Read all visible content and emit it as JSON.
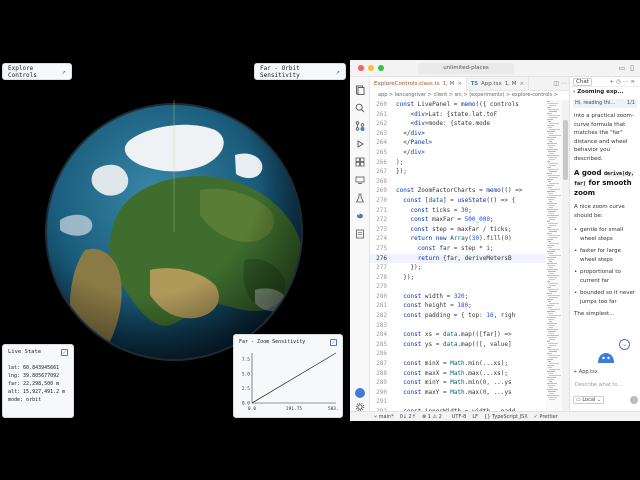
{
  "globe": {
    "explore_title": "Explore Controls",
    "orbit_title": "Far - Orbit Sensitivity",
    "live_state": {
      "title": "Live State",
      "lat": "lat: 60.843945661",
      "lng": "lng: 39.805677092",
      "far": "far: 22,298,500 m",
      "alt": "alt: 15,927,491.2 m",
      "mode": "mode: orbit"
    },
    "zoom_chart": {
      "title": "Far - Zoom Sensitivity"
    }
  },
  "chart_data": {
    "type": "line",
    "title": "Far - Zoom Sensitivity",
    "xlabel": "",
    "ylabel": "",
    "x_ticks": [
      "0.0",
      "291.75",
      "583.50"
    ],
    "y_ticks": [
      "7.5",
      "5.0",
      "2.5",
      "0.0"
    ],
    "xlim": [
      0,
      583.5
    ],
    "ylim": [
      0,
      8.6
    ],
    "series": [
      {
        "x": [
          0,
          583.5
        ],
        "y": [
          0,
          8.6
        ]
      }
    ]
  },
  "editor": {
    "title_search": "unlimited-places",
    "tabs": [
      {
        "label": "ExploreControls.class.ts",
        "suffix": "1, M"
      },
      {
        "label": "App.tsx",
        "suffix": "1, M",
        "badge": "TS"
      }
    ],
    "breadcrumb": "app > lancangriver > client > src > (experiments) > explore-controls >",
    "code_lines": [
      {
        "n": "260",
        "t": "const LivePanel = memo(({ controls"
      },
      {
        "n": "261",
        "t": "    <div>Lat: {state.lat.toF"
      },
      {
        "n": "262",
        "t": "    <div>mode: {state.mode"
      },
      {
        "n": "263",
        "t": "  </div>"
      },
      {
        "n": "264",
        "t": "  </Panel>"
      },
      {
        "n": "265",
        "t": "  </div>"
      },
      {
        "n": "266",
        "t": ");"
      },
      {
        "n": "267",
        "t": "});"
      },
      {
        "n": "268",
        "t": ""
      },
      {
        "n": "269",
        "t": "const ZoomFactorCharts = memo(() =>"
      },
      {
        "n": "270",
        "t": "  const [data] = useState(() => {"
      },
      {
        "n": "271",
        "t": "    const ticks = 30;"
      },
      {
        "n": "272",
        "t": "    const maxFar = 500_000;"
      },
      {
        "n": "273",
        "t": "    const step = maxFar / ticks;"
      },
      {
        "n": "274",
        "t": "    return new Array(30).fill(0)"
      },
      {
        "n": "275",
        "t": "      const far = step * i;"
      },
      {
        "n": "276",
        "t": "      return {far, deriveMetersB"
      },
      {
        "n": "277",
        "t": "    });"
      },
      {
        "n": "278",
        "t": "  });"
      },
      {
        "n": "279",
        "t": ""
      },
      {
        "n": "280",
        "t": "  const width = 320;"
      },
      {
        "n": "281",
        "t": "  const height = 180;"
      },
      {
        "n": "282",
        "t": "  const padding = { top: 16, righ"
      },
      {
        "n": "283",
        "t": ""
      },
      {
        "n": "284",
        "t": "  const xs = data.map(([far]) =>"
      },
      {
        "n": "285",
        "t": "  const ys = data.map(([, value]"
      },
      {
        "n": "286",
        "t": ""
      },
      {
        "n": "287",
        "t": "  const minX = Math.min(...xs);"
      },
      {
        "n": "288",
        "t": "  const maxX = Math.max(...xs);"
      },
      {
        "n": "289",
        "t": "  const minY = Math.min(0, ...ys"
      },
      {
        "n": "290",
        "t": "  const maxY = Math.max(0, ...ys"
      },
      {
        "n": "291",
        "t": ""
      },
      {
        "n": "292",
        "t": "  const innerWidth = width - padd"
      },
      {
        "n": "293",
        "t": "  const innerHeight = height - pa"
      }
    ],
    "chat": {
      "tab": "Chat",
      "subtitle": "Zooming exp...",
      "preview": "Hi, reading thi...",
      "preview_count": "1/1",
      "intro": "into a practical zoom-curve formula that matches the \"far\" distance and wheel behavior you described.",
      "heading_pre": "A good",
      "heading_code": "derive(dy, far)",
      "heading_post": "for smooth zoom",
      "lead": "A nice zoom curve should be:",
      "bullets": [
        "gentle for small wheel steps",
        "faster for large wheel steps",
        "proportional to current far",
        "bounded so it never jumps too far"
      ],
      "partial": "The simplest...",
      "file_chip": "App.tsx",
      "input_placeholder": "Describe what to...",
      "local_label": "Local"
    },
    "status": {
      "branch": "main*",
      "sync": "0↓ 2↑",
      "problems": "1",
      "warnings": "2",
      "encoding": "UTF-8",
      "eol": "LF",
      "language": "TypeScript JSX",
      "formatter": "Prettier"
    }
  }
}
